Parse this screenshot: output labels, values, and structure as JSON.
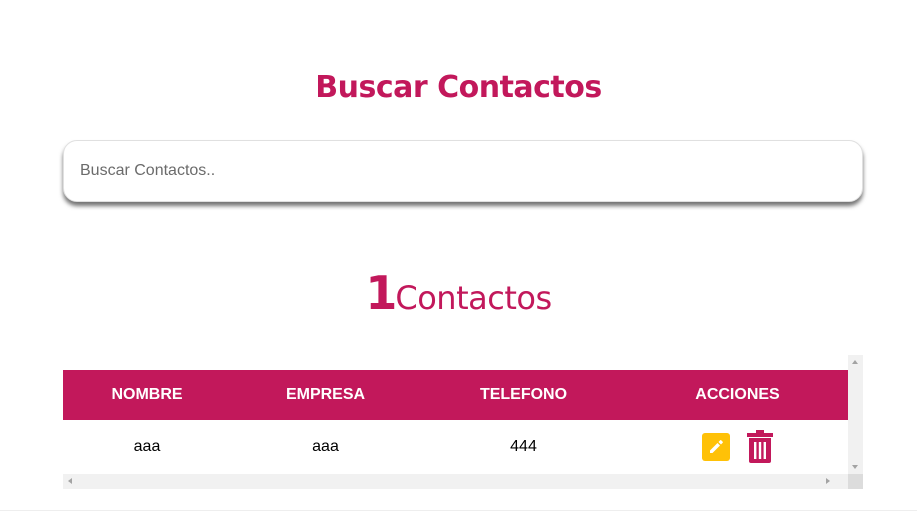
{
  "header": {
    "title": "Buscar Contactos"
  },
  "search": {
    "placeholder": "Buscar Contactos..",
    "value": ""
  },
  "summary": {
    "count": "1",
    "label": "Contactos"
  },
  "table": {
    "columns": [
      "NOMBRE",
      "EMPRESA",
      "TELEFONO",
      "ACCIONES"
    ],
    "rows": [
      {
        "nombre": "aaa",
        "empresa": "aaa",
        "telefono": "444"
      }
    ]
  },
  "colors": {
    "accent": "#c2185b",
    "edit": "#ffc107",
    "delete": "#c2185b"
  },
  "icons": {
    "edit": "pencil-icon",
    "delete": "trash-icon"
  }
}
